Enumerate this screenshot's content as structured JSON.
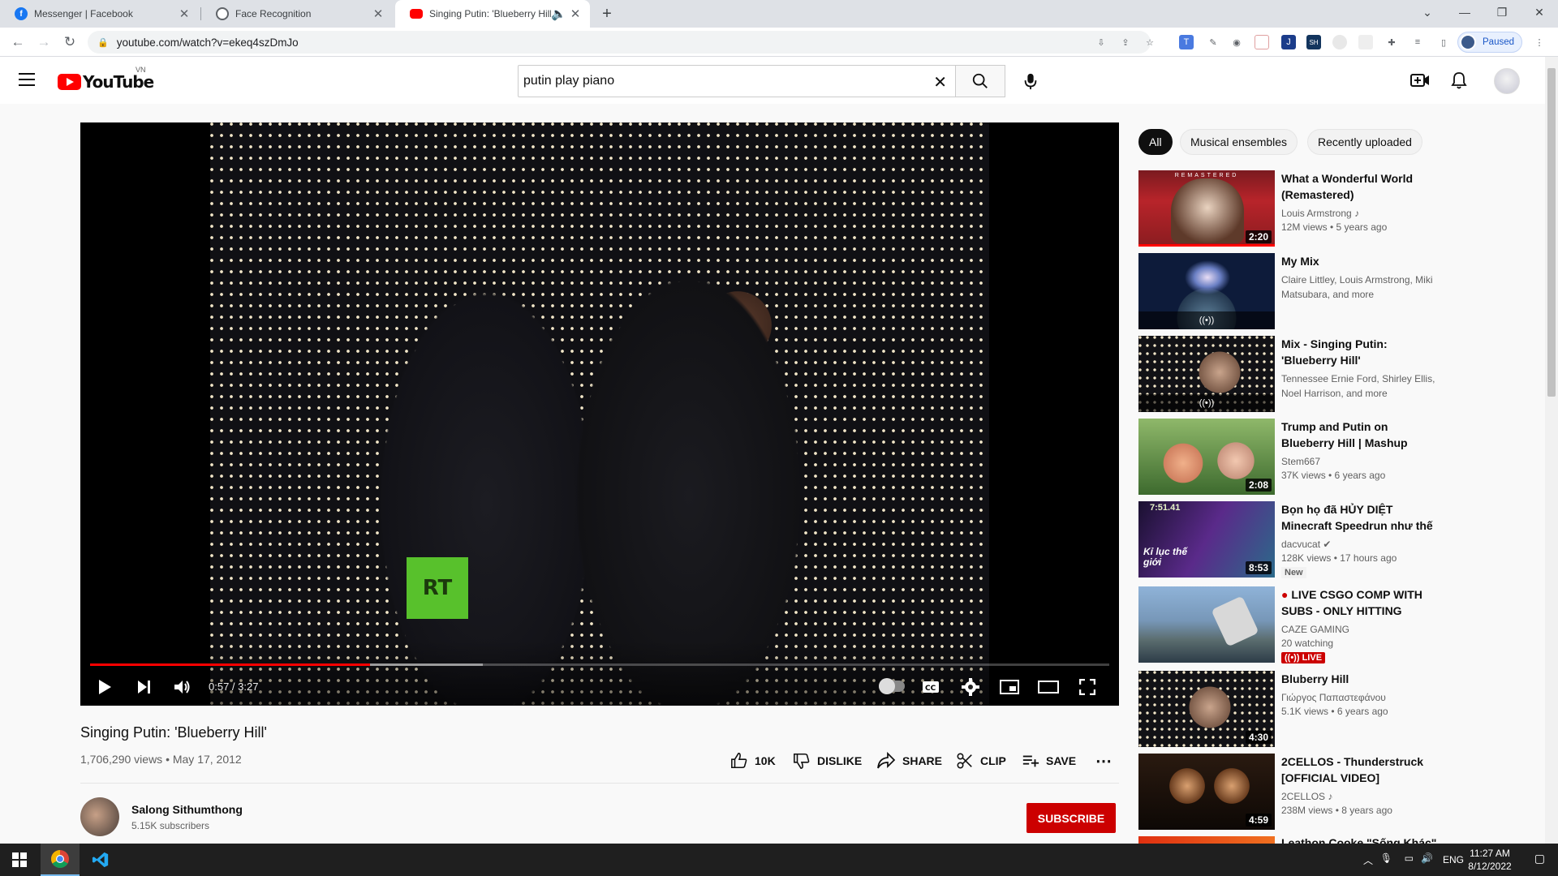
{
  "browser": {
    "tabs": [
      {
        "title": "Messenger | Facebook",
        "active": false
      },
      {
        "title": "Face Recognition",
        "active": false
      },
      {
        "title": "Singing Putin: 'Blueberry Hill'",
        "active": true
      }
    ],
    "url": "youtube.com/watch?v=ekeq4szDmJo",
    "profile_status": "Paused"
  },
  "youtube": {
    "logo_text": "YouTube",
    "country_code": "VN",
    "search_query": "putin play piano"
  },
  "player": {
    "current_time_display": "0:57 / 3:27",
    "progress_fraction": 0.275,
    "buffered_fraction": 0.385,
    "channel_watermark": "RT"
  },
  "video": {
    "title": "Singing Putin: 'Blueberry Hill'",
    "meta": "1,706,290 views • May 17, 2012",
    "actions": {
      "like_count": "10K",
      "dislike": "DISLIKE",
      "share": "SHARE",
      "clip": "CLIP",
      "save": "SAVE"
    },
    "channel": {
      "name": "Salong Sithumthong",
      "subscribers": "5.15K subscribers"
    },
    "subscribe_label": "SUBSCRIBE"
  },
  "chips": [
    "All",
    "Musical ensembles",
    "Recently uploaded"
  ],
  "recommendations": [
    {
      "title": "What a Wonderful World (Remastered)",
      "channel": "Louis Armstrong",
      "stats": "12M views • 5 years ago",
      "duration": "2:20",
      "thumb_text": "REMASTERED"
    },
    {
      "title": "My Mix",
      "channel": "Claire Littley, Louis Armstrong, Miki Matsubara, and more",
      "mix": true
    },
    {
      "title": "Mix - Singing Putin: 'Blueberry Hill'",
      "channel": "Tennessee Ernie Ford, Shirley Ellis, Noel Harrison, and more",
      "mix": true
    },
    {
      "title": "Trump and Putin on Blueberry Hill | Mashup",
      "channel": "Stem667",
      "stats": "37K views • 6 years ago",
      "duration": "2:08"
    },
    {
      "title": "Bọn họ đã HỦY DIỆT Minecraft Speedrun như thế nào ?",
      "channel": "dacvucat",
      "stats": "128K views • 17 hours ago",
      "duration": "8:53",
      "badge": "New",
      "thumb_text": "7:51.41",
      "thumb_caption": "Kỉ lục thế giới"
    },
    {
      "title": "LIVE CSGO COMP WITH SUBS - ONLY HITTING EPIC...",
      "channel": "CAZE GAMING",
      "stats": "20 watching",
      "live": "LIVE"
    },
    {
      "title": "Bluberry Hill",
      "channel": "Γιώργος Παπαστεφάνου",
      "stats": "5.1K views • 6 years ago",
      "duration": "4:30"
    },
    {
      "title": "2CELLOS - Thunderstruck [OFFICIAL VIDEO]",
      "channel": "2CELLOS",
      "stats": "238M views • 8 years ago",
      "duration": "4:59"
    },
    {
      "title": "Leathon Cooke \"Sống Khác\" |"
    }
  ],
  "taskbar": {
    "language": "ENG",
    "time": "11:27 AM",
    "date": "8/12/2022"
  },
  "colors": {
    "youtube_red": "#ff0000",
    "subscribe_red": "#cc0000",
    "chrome_tabstrip": "#dee1e6",
    "taskbar": "#1f1f1f"
  }
}
